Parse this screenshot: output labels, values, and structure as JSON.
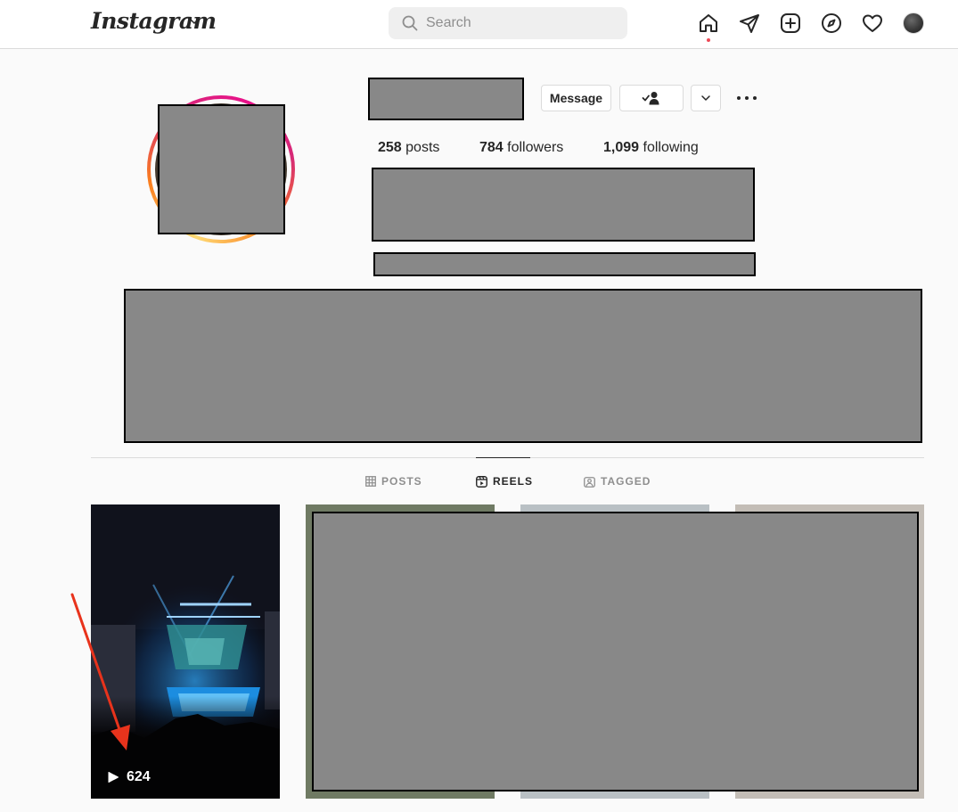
{
  "header": {
    "logo": "Instagram",
    "search_placeholder": "Search",
    "nav_icons": [
      "home-icon",
      "direct-messages-icon",
      "new-post-icon",
      "explore-icon",
      "activity-heart-icon",
      "profile-avatar"
    ]
  },
  "profile": {
    "message_label": "Message",
    "stats": {
      "posts_count": "258",
      "posts_label": "posts",
      "followers_count": "784",
      "followers_label": "followers",
      "following_count": "1,099",
      "following_label": "following"
    }
  },
  "tabs": [
    {
      "label": "POSTS",
      "icon": "grid-icon",
      "active": false
    },
    {
      "label": "REELS",
      "icon": "reels-icon",
      "active": true
    },
    {
      "label": "TAGGED",
      "icon": "tagged-icon",
      "active": false
    }
  ],
  "reels": [
    {
      "views": "624"
    }
  ],
  "colors": {
    "accent_red": "#ed4956",
    "annotation_arrow": "#e8331c",
    "redaction": "#888888"
  }
}
